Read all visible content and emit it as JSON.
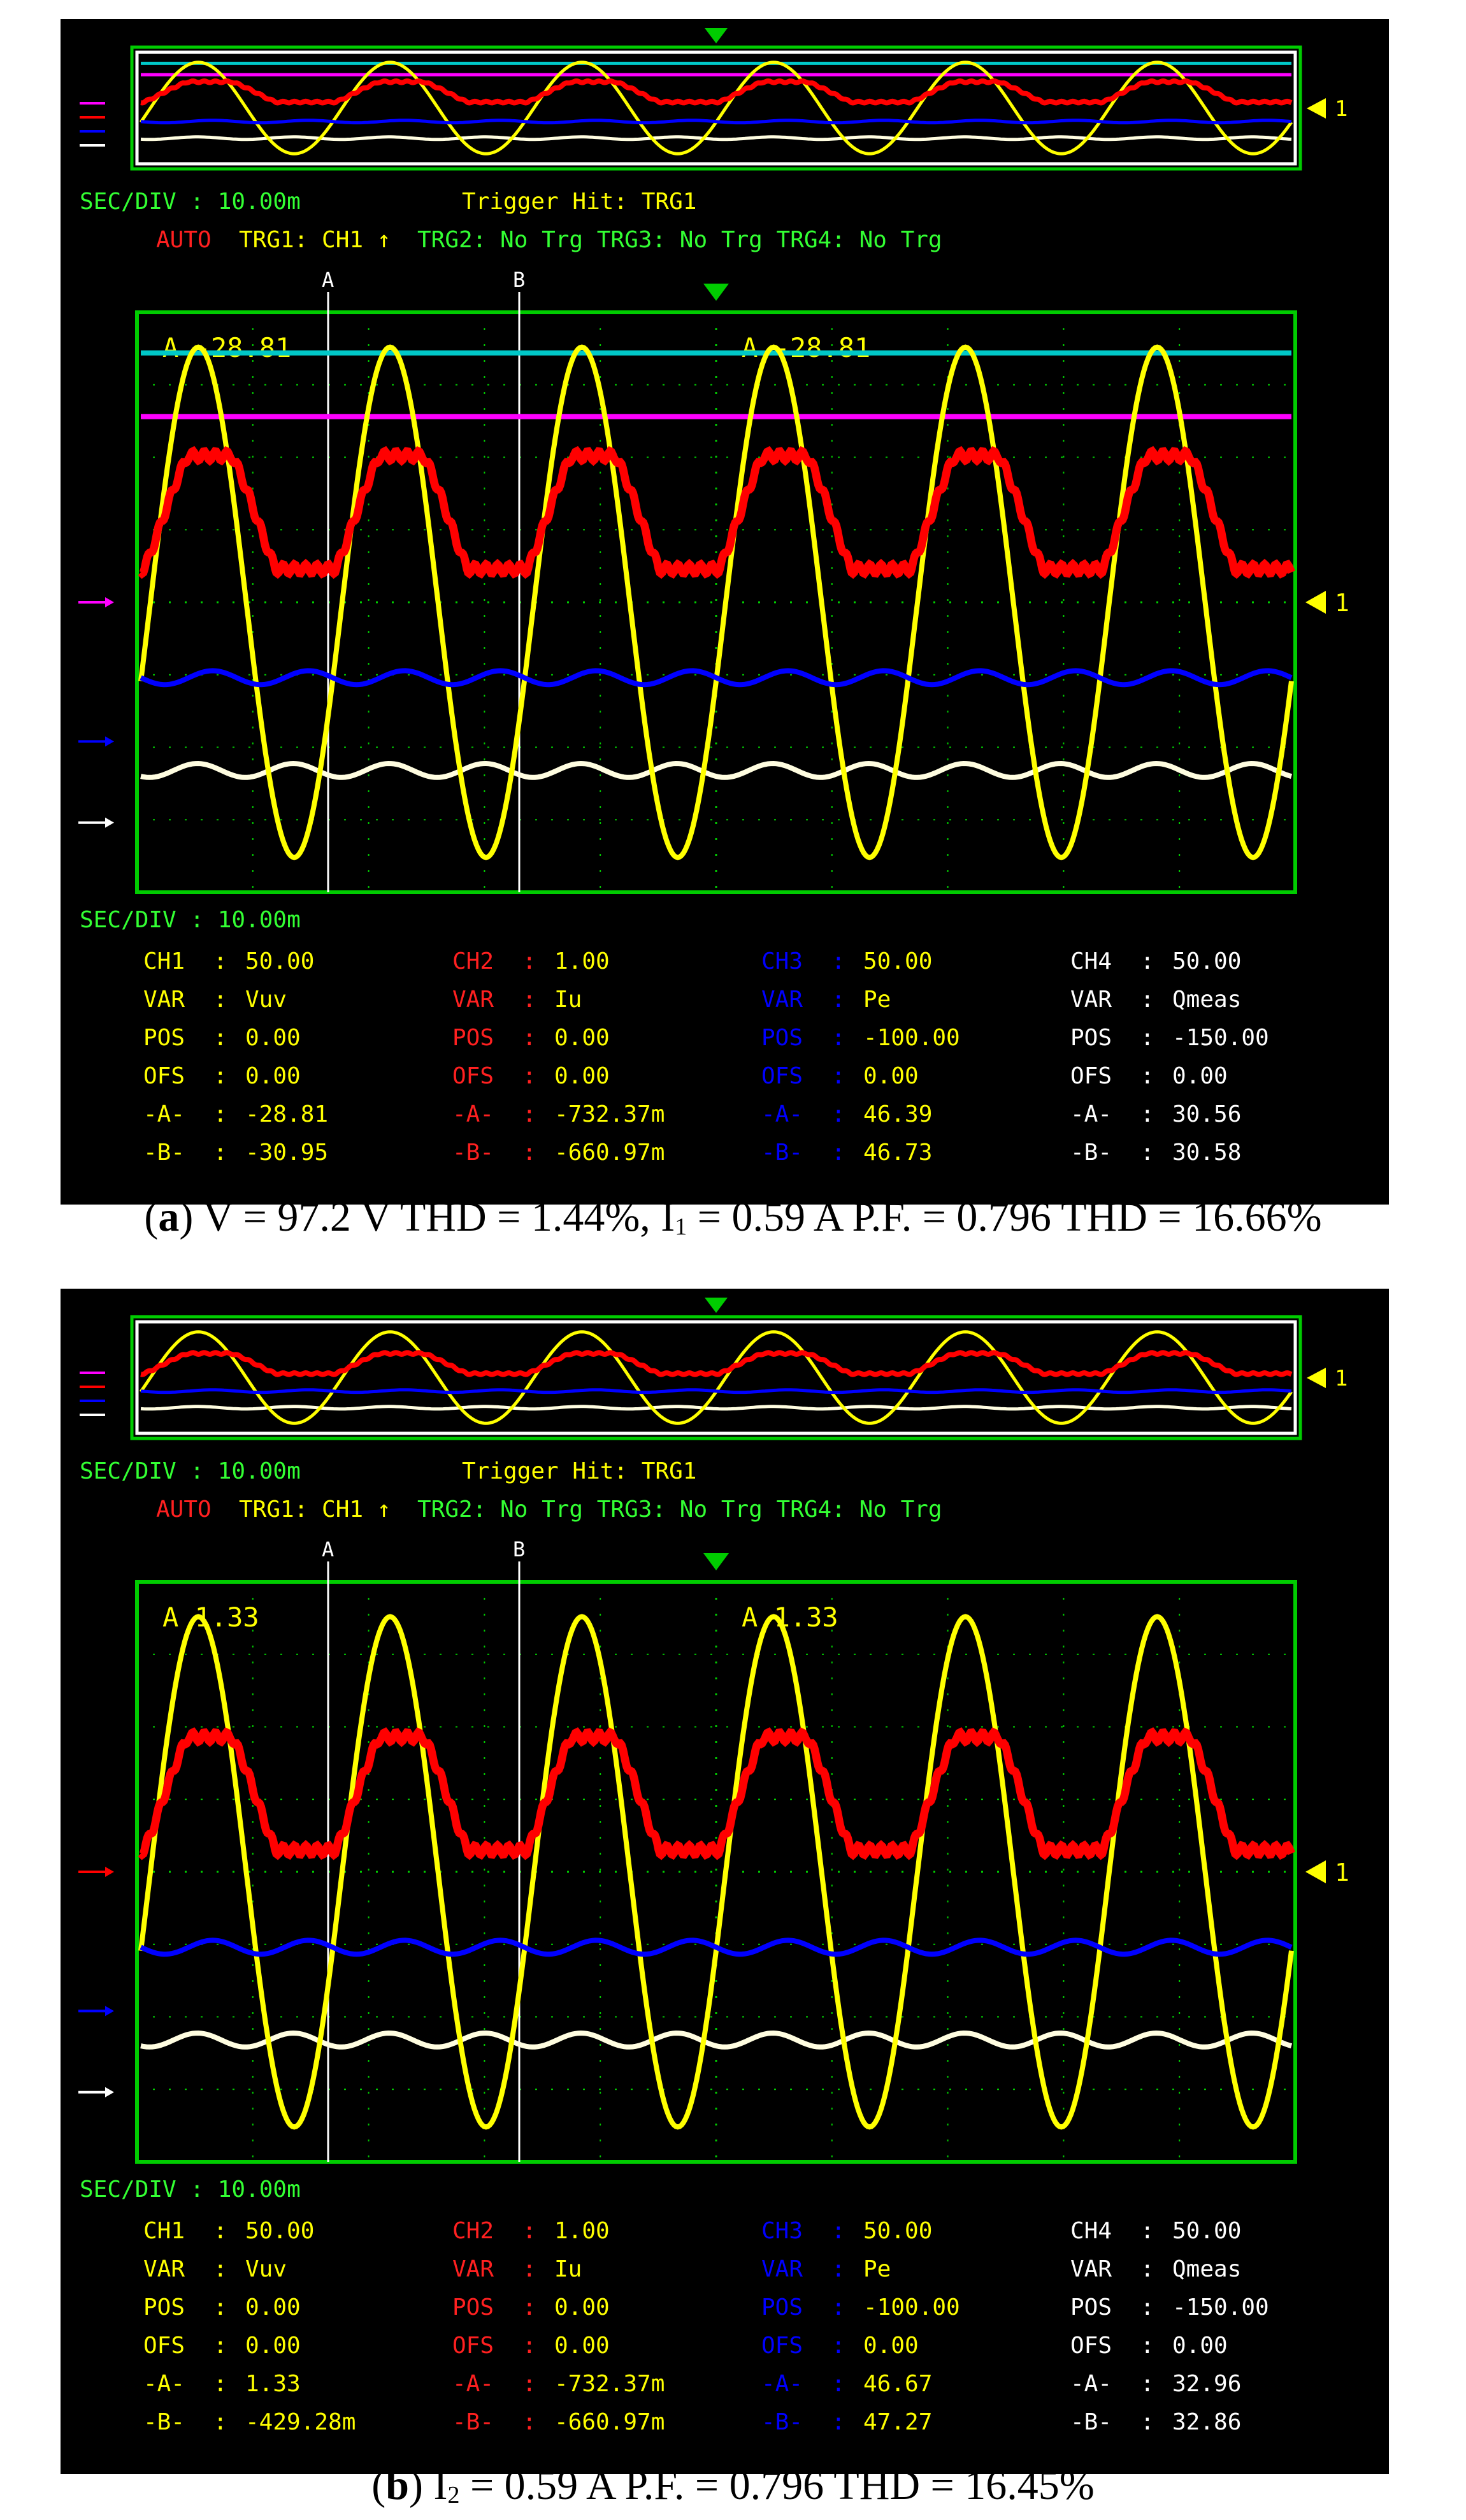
{
  "colors": {
    "ch1": "#ffff00",
    "ch2": "#ff0000",
    "ch3": "#0000ff",
    "ch4": "#fffde0",
    "magenta": "#ff00ff",
    "cyan": "#00c8c8",
    "grid": "#00cc00",
    "label_green": "#33ff33",
    "label_yellow": "#ffff00",
    "label_red": "#ff2020",
    "label_blue": "#0000ff",
    "label_white": "#ffffff"
  },
  "panels": [
    {
      "id": "a",
      "sec_div_top": "SEC/DIV : 10.00m",
      "trigger_hit": "Trigger Hit: TRG1",
      "trigger_line": {
        "auto": "AUTO",
        "trg1": "TRG1: CH1 ↑",
        "rest": "TRG2: No Trg TRG3: No Trg TRG4: No Trg"
      },
      "cursor_a_label": "A",
      "cursor_b_label": "B",
      "readout_left": "A -28.81",
      "readout_right": "A -28.81",
      "marker_one_top": "1",
      "marker_one_main": "1",
      "sec_div_bottom": "SEC/DIV : 10.00m",
      "show_cyan": true,
      "show_magenta": true,
      "channels": [
        {
          "key": "CH1",
          "ch_value": "50.00",
          "var": "Vuv",
          "pos": "0.00",
          "ofs": "0.00",
          "a": "-28.81",
          "b": "-30.95",
          "label_color": "#ffff00",
          "value_color": "#ffff00"
        },
        {
          "key": "CH2",
          "ch_value": "1.00",
          "var": "Iu",
          "pos": "0.00",
          "ofs": "0.00",
          "a": "-732.37m",
          "b": "-660.97m",
          "label_color": "#ff2020",
          "value_color": "#ffff00"
        },
        {
          "key": "CH3",
          "ch_value": "50.00",
          "var": "Pe",
          "pos": "-100.00",
          "ofs": "0.00",
          "a": "46.39",
          "b": "46.73",
          "label_color": "#0000ff",
          "value_color": "#ffff00"
        },
        {
          "key": "CH4",
          "ch_value": "50.00",
          "var": "Qmeas",
          "pos": "-150.00",
          "ofs": "0.00",
          "a": "30.56",
          "b": "30.58",
          "label_color": "#ffffff",
          "value_color": "#ffff00"
        }
      ],
      "caption_label": "a",
      "caption_pre": "V = 97.2 V THD = 1.44%, I",
      "caption_sub": "1",
      "caption_post": " = 0.59 A P.F. = 0.796 THD = 16.66%"
    },
    {
      "id": "b",
      "sec_div_top": "SEC/DIV : 10.00m",
      "trigger_hit": "Trigger Hit: TRG1",
      "trigger_line": {
        "auto": "AUTO",
        "trg1": "TRG1: CH1 ↑",
        "rest": "TRG2: No Trg TRG3: No Trg TRG4: No Trg"
      },
      "cursor_a_label": "A",
      "cursor_b_label": "B",
      "readout_left": "A 1.33",
      "readout_right": "A 1.33",
      "marker_one_top": "1",
      "marker_one_main": "1",
      "sec_div_bottom": "SEC/DIV : 10.00m",
      "show_cyan": false,
      "show_magenta": false,
      "channels": [
        {
          "key": "CH1",
          "ch_value": "50.00",
          "var": "Vuv",
          "pos": "0.00",
          "ofs": "0.00",
          "a": "1.33",
          "b": "-429.28m",
          "label_color": "#ffff00",
          "value_color": "#ffff00"
        },
        {
          "key": "CH2",
          "ch_value": "1.00",
          "var": "Iu",
          "pos": "0.00",
          "ofs": "0.00",
          "a": "-732.37m",
          "b": "-660.97m",
          "label_color": "#ff2020",
          "value_color": "#ffff00"
        },
        {
          "key": "CH3",
          "ch_value": "50.00",
          "var": "Pe",
          "pos": "-100.00",
          "ofs": "0.00",
          "a": "46.67",
          "b": "47.27",
          "label_color": "#0000ff",
          "value_color": "#ffff00"
        },
        {
          "key": "CH4",
          "ch_value": "50.00",
          "var": "Qmeas",
          "pos": "-150.00",
          "ofs": "0.00",
          "a": "32.96",
          "b": "32.86",
          "label_color": "#ffffff",
          "value_color": "#ffff00"
        }
      ],
      "caption_label": "b",
      "caption_pre": "I",
      "caption_sub": "2",
      "caption_post": " = 0.59 A P.F. = 0.796 THD = 16.45%"
    }
  ],
  "row_labels": {
    "var": "VAR",
    "pos": "POS",
    "ofs": "OFS",
    "a": "-A-",
    "b": "-B-",
    "sep": ":"
  }
}
